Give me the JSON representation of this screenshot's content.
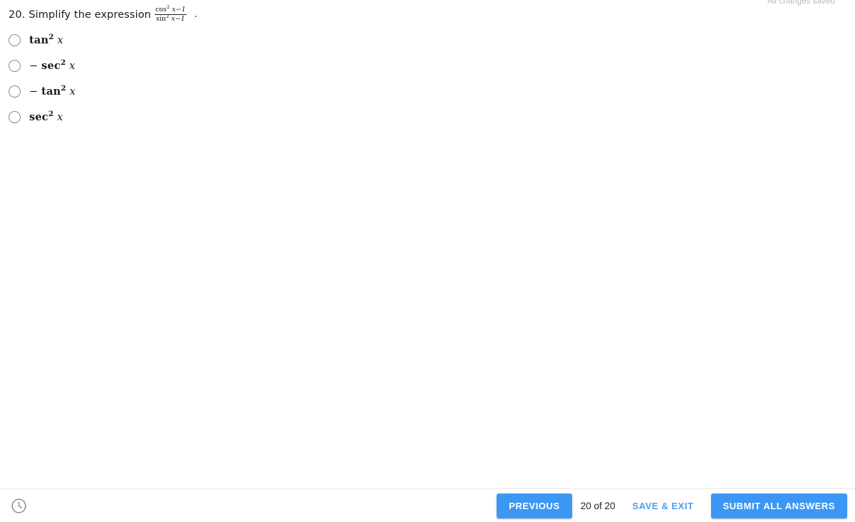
{
  "status": {
    "saved_text": "All changes saved"
  },
  "question": {
    "number_label": "20.",
    "prompt": "Simplify the expression",
    "expression": {
      "numerator": "cos² x − 1",
      "denominator": "sin² x − 1",
      "numerator_fn": "cos",
      "numerator_exp": "2",
      "numerator_rest": "x−1",
      "denominator_fn": "sin",
      "denominator_exp": "2",
      "denominator_rest": "x−1"
    },
    "trailing_punctuation": "."
  },
  "options": [
    {
      "id": "option-a",
      "sign": "",
      "fn": "tan",
      "exp": "2",
      "var": "x",
      "text": "tan² x",
      "selected": false
    },
    {
      "id": "option-b",
      "sign": "− ",
      "fn": "sec",
      "exp": "2",
      "var": "x",
      "text": "− sec² x",
      "selected": false
    },
    {
      "id": "option-c",
      "sign": "− ",
      "fn": "tan",
      "exp": "2",
      "var": "x",
      "text": "− tan² x",
      "selected": false
    },
    {
      "id": "option-d",
      "sign": "",
      "fn": "sec",
      "exp": "2",
      "var": "x",
      "text": "sec² x",
      "selected": false
    }
  ],
  "footer": {
    "timer_icon": "clock-icon",
    "previous_label": "PREVIOUS",
    "page_counter": "20 of 20",
    "save_exit_label": "SAVE & EXIT",
    "submit_label": "SUBMIT ALL ANSWERS"
  },
  "colors": {
    "accent_blue": "#3b97f3",
    "text_blue": "#4d9ff0",
    "text_dark": "#1a1a1a",
    "radio_border": "#8a8a8a",
    "scrollbar": "#0a0a0a",
    "saved_text": "#b9b9b9"
  },
  "scrollbar": {
    "name": "horizontal-scrollbar"
  }
}
